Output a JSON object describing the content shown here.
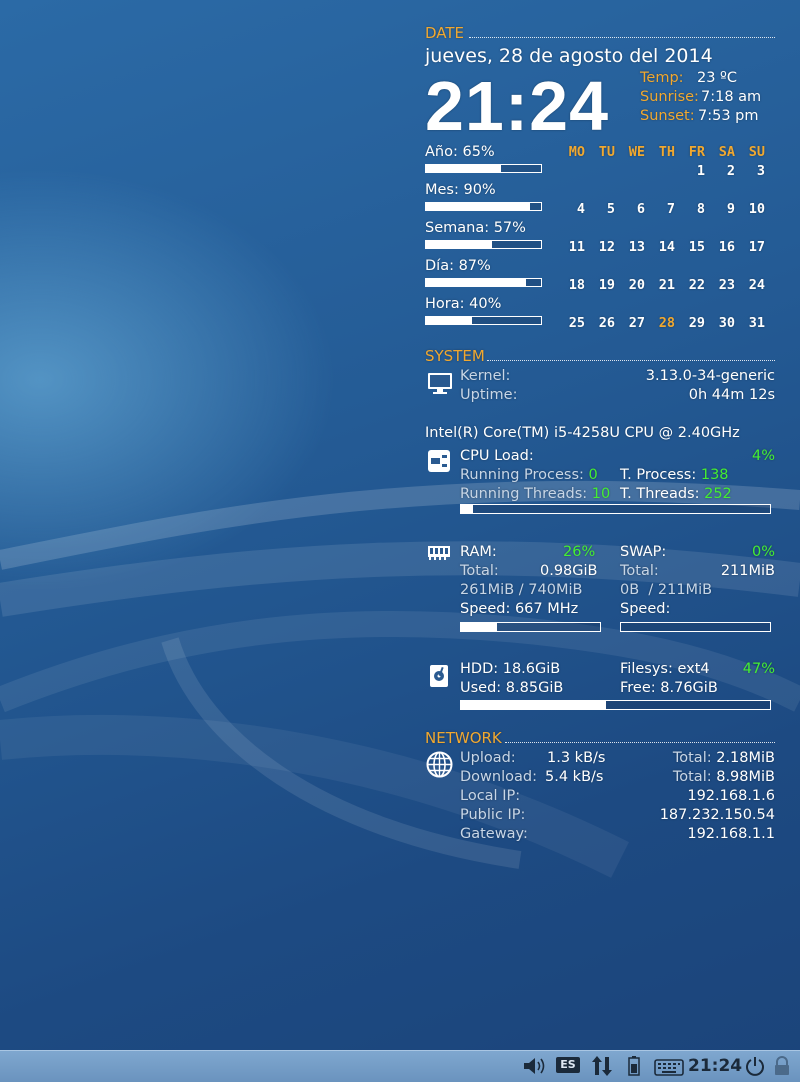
{
  "date": {
    "header": "DATE",
    "full_date": "jueves, 28 de agosto del 2014",
    "time": "21:24",
    "temp_label": "Temp:",
    "temp_value": "23 ºC",
    "sunrise_label": "Sunrise:",
    "sunrise_value": "7:18 am",
    "sunset_label": "Sunset:",
    "sunset_value": "7:53 pm"
  },
  "progress": [
    {
      "label": "Año: 65%",
      "value": 0.65
    },
    {
      "label": "Mes: 90%",
      "value": 0.9
    },
    {
      "label": "Semana: 57%",
      "value": 0.57
    },
    {
      "label": "Día: 87%",
      "value": 0.87
    },
    {
      "label": "Hora: 40%",
      "value": 0.4
    }
  ],
  "calendar": {
    "weekdays": [
      "MO",
      "TU",
      "WE",
      "TH",
      "FR",
      "SA",
      "SU"
    ],
    "weeks": [
      [
        "",
        "",
        "",
        "",
        "1",
        "2",
        "3"
      ],
      [
        "4",
        "5",
        "6",
        "7",
        "8",
        "9",
        "10"
      ],
      [
        "11",
        "12",
        "13",
        "14",
        "15",
        "16",
        "17"
      ],
      [
        "18",
        "19",
        "20",
        "21",
        "22",
        "23",
        "24"
      ],
      [
        "25",
        "26",
        "27",
        "28",
        "29",
        "30",
        "31"
      ]
    ],
    "today": "28"
  },
  "system": {
    "header": "SYSTEM",
    "kernel_label": "Kernel:",
    "kernel_value": "3.13.0-34-generic",
    "uptime_label": "Uptime:",
    "uptime_value": "0h 44m 12s",
    "cpu_name": "Intel(R) Core(TM) i5-4258U CPU @ 2.40GHz",
    "cpu_load_label": "CPU Load:",
    "cpu_load_value": "4%",
    "cpu_load_fraction": 0.04,
    "running_process_label": "Running Process:",
    "running_process_value": "0",
    "t_process_label": "T. Process:",
    "t_process_value": "138",
    "running_threads_label": "Running Threads:",
    "running_threads_value": "10",
    "t_threads_label": "T. Threads:",
    "t_threads_value": "252",
    "ram_label": "RAM:",
    "ram_pct": "26%",
    "ram_fraction": 0.26,
    "ram_total_label": "Total:",
    "ram_total_value": "0.98GiB",
    "ram_used": "261MiB / 740MiB",
    "ram_speed": "Speed: 667 MHz",
    "swap_label": "SWAP:",
    "swap_pct": "0%",
    "swap_fraction": 0.0,
    "swap_total_label": "Total:",
    "swap_total_value": "211MiB",
    "swap_used": "0B  / 211MiB",
    "swap_speed": "Speed:",
    "hdd_label": "HDD: 18.6GiB",
    "used_label": "Used:",
    "used_value": "8.85GiB",
    "filesys_label": "Filesys: ext4",
    "filesys_pct": "47%",
    "disk_fraction": 0.47,
    "free_label": "Free:",
    "free_value": "8.76GiB"
  },
  "network": {
    "header": "NETWORK",
    "upload_label": "Upload:",
    "upload_value": "1.3 kB/s",
    "upload_total_label": "Total:",
    "upload_total_value": "2.18MiB",
    "download_label": "Download:",
    "download_value": "5.4 kB/s",
    "download_total_label": "Total:",
    "download_total_value": "8.98MiB",
    "local_ip_label": "Local IP:",
    "local_ip_value": "192.168.1.6",
    "public_ip_label": "Public IP:",
    "public_ip_value": "187.232.150.54",
    "gateway_label": "Gateway:",
    "gateway_value": "192.168.1.1"
  },
  "taskbar": {
    "keyboard_layout": "ES",
    "clock": "21:24",
    "icons": [
      "volume-icon",
      "keyboard-layout-icon",
      "network-icon",
      "battery-icon",
      "keyboard-icon",
      "power-icon",
      "lock-icon"
    ]
  },
  "colors": {
    "accent": "#f0a830",
    "highlight": "#44ee33",
    "background": "#245b95"
  }
}
